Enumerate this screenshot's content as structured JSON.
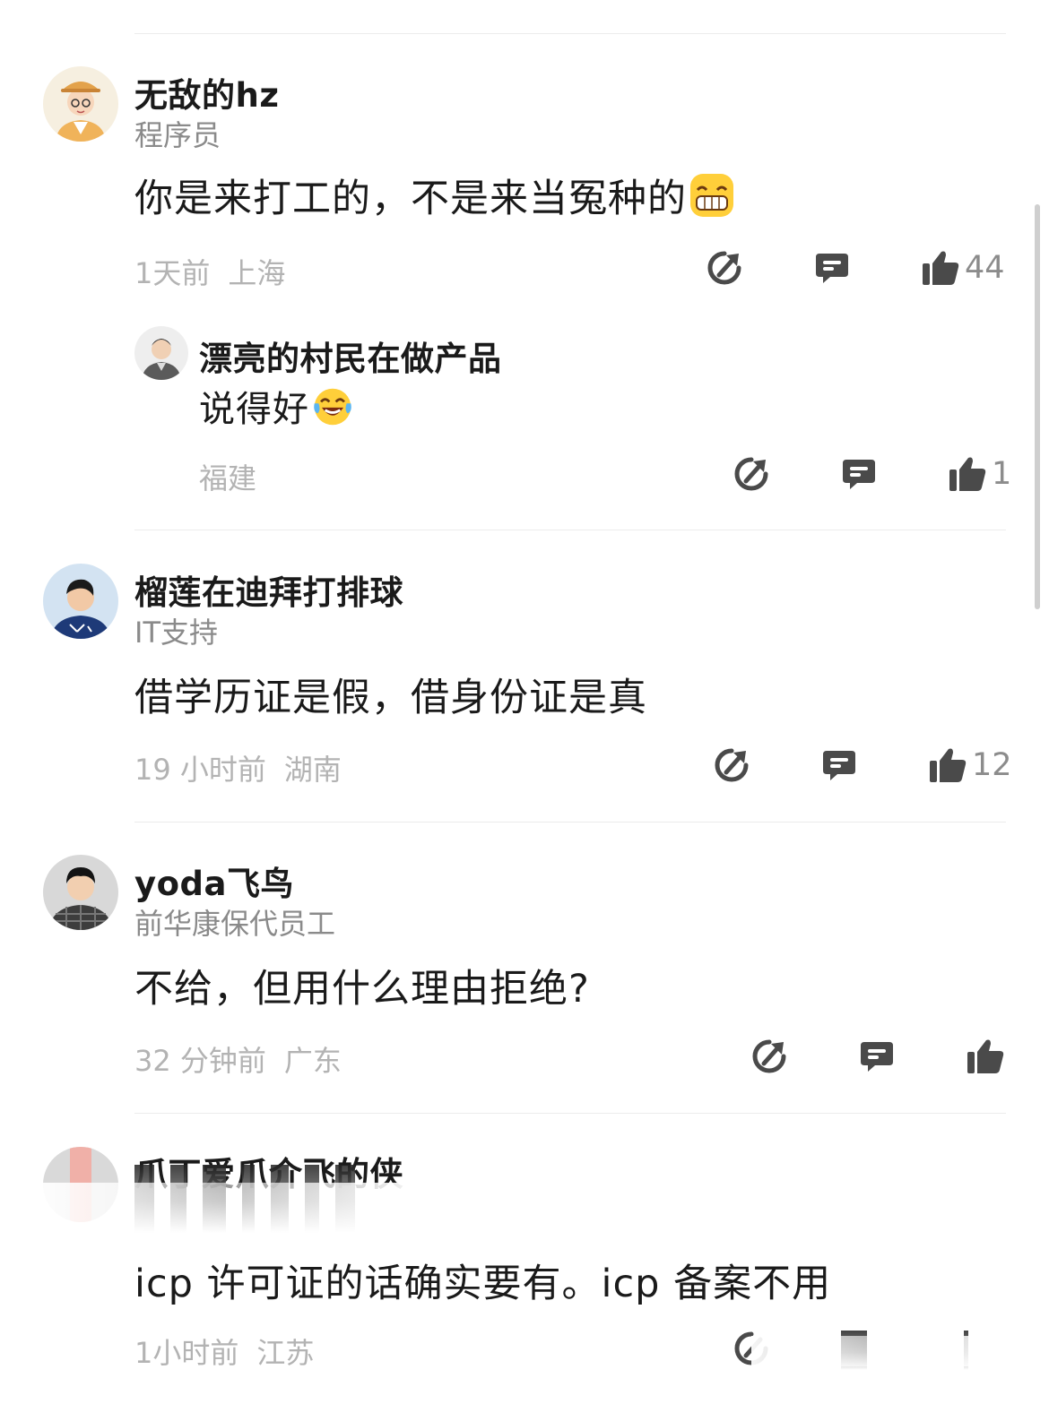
{
  "comments": [
    {
      "author": "无敌的hz",
      "title": "程序员",
      "text": "你是来打工的，不是来当冤种的",
      "emoji": "grin-emoji",
      "time": "1天前",
      "location": "上海",
      "likes": "44",
      "replies": [
        {
          "author": "漂亮的村民在做产品",
          "text": "说得好",
          "emoji": "laugh-tears-emoji",
          "location": "福建",
          "likes": "1"
        }
      ]
    },
    {
      "author": "榴莲在迪拜打排球",
      "title": "IT支持",
      "text": "借学历证是假，借身份证是真",
      "time": "19 小时前",
      "location": "湖南",
      "likes": "12"
    },
    {
      "author": "yoda飞鸟",
      "title": "前华康保代员工",
      "text": "不给，但用什么理由拒绝?",
      "time": "32 分钟前",
      "location": "广东",
      "likes": ""
    },
    {
      "author": "爪丁爱爪介飞的侠",
      "title": "",
      "text": "icp 许可证的话确实要有。icp 备案不用",
      "time": "1小时前",
      "location": "江苏",
      "likes": ""
    }
  ],
  "icons": [
    "share-icon",
    "reply-icon",
    "like-icon"
  ],
  "colors": {
    "text": "#1a1a1a",
    "muted": "#8a8a8a",
    "meta": "#b3b3b3",
    "icon": "#4a4a4a",
    "divider": "#ececec"
  }
}
